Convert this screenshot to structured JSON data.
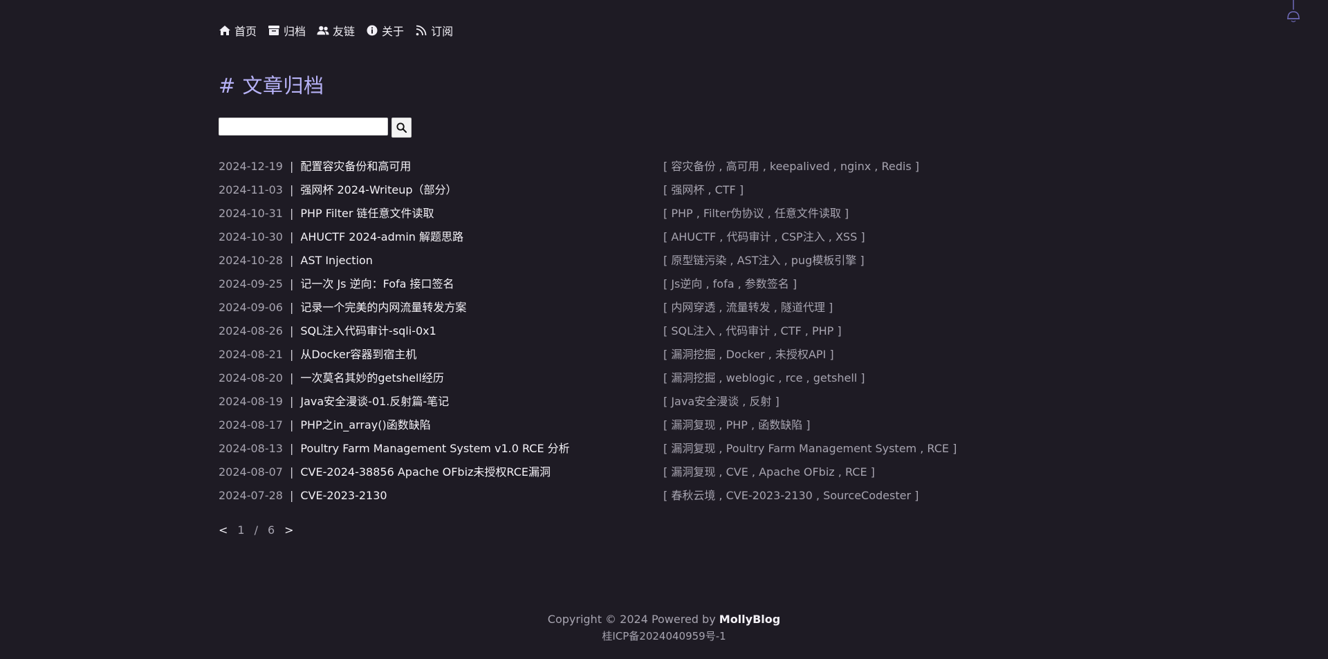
{
  "nav": {
    "items": [
      {
        "label": "首页",
        "icon": "home-icon"
      },
      {
        "label": "归档",
        "icon": "archive-icon"
      },
      {
        "label": "友链",
        "icon": "users-icon"
      },
      {
        "label": "关于",
        "icon": "info-icon"
      },
      {
        "label": "订阅",
        "icon": "rss-icon"
      }
    ]
  },
  "title": "# 文章归档",
  "search": {
    "value": "",
    "placeholder": ""
  },
  "posts": [
    {
      "date": "2024-12-19",
      "title": "配置容灾备份和高可用",
      "tags": [
        "容灾备份",
        "高可用",
        "keepalived",
        "nginx",
        "Redis"
      ]
    },
    {
      "date": "2024-11-03",
      "title": "强网杯 2024-Writeup（部分）",
      "tags": [
        "强网杯",
        "CTF"
      ]
    },
    {
      "date": "2024-10-31",
      "title": "PHP Filter 链任意文件读取",
      "tags": [
        "PHP",
        "Filter伪协议",
        "任意文件读取"
      ]
    },
    {
      "date": "2024-10-30",
      "title": "AHUCTF 2024-admin 解题思路",
      "tags": [
        "AHUCTF",
        "代码审计",
        "CSP注入",
        "XSS"
      ]
    },
    {
      "date": "2024-10-28",
      "title": "AST Injection",
      "tags": [
        "原型链污染",
        "AST注入",
        "pug模板引擎"
      ]
    },
    {
      "date": "2024-09-25",
      "title": "记一次 Js 逆向：Fofa 接口签名",
      "tags": [
        "Js逆向",
        "fofa",
        "参数签名"
      ]
    },
    {
      "date": "2024-09-06",
      "title": "记录一个完美的内网流量转发方案",
      "tags": [
        "内网穿透",
        "流量转发",
        "隧道代理"
      ]
    },
    {
      "date": "2024-08-26",
      "title": "SQL注入代码审计-sqli-0x1",
      "tags": [
        "SQL注入",
        "代码审计",
        "CTF",
        "PHP"
      ]
    },
    {
      "date": "2024-08-21",
      "title": "从Docker容器到宿主机",
      "tags": [
        "漏洞挖掘",
        "Docker",
        "未授权API"
      ]
    },
    {
      "date": "2024-08-20",
      "title": "一次莫名其妙的getshell经历",
      "tags": [
        "漏洞挖掘",
        "weblogic",
        "rce",
        "getshell"
      ]
    },
    {
      "date": "2024-08-19",
      "title": "Java安全漫谈-01.反射篇-笔记",
      "tags": [
        "Java安全漫谈",
        "反射"
      ]
    },
    {
      "date": "2024-08-17",
      "title": "PHP之in_array()函数缺陷",
      "tags": [
        "漏洞复现",
        "PHP",
        "函数缺陷"
      ]
    },
    {
      "date": "2024-08-13",
      "title": "Poultry Farm Management System v1.0 RCE 分析",
      "tags": [
        "漏洞复现",
        "Poultry Farm Management System",
        "RCE"
      ]
    },
    {
      "date": "2024-08-07",
      "title": "CVE-2024-38856 Apache OFbiz未授权RCE漏洞",
      "tags": [
        "漏洞复现",
        "CVE",
        "Apache OFbiz",
        "RCE"
      ]
    },
    {
      "date": "2024-07-28",
      "title": "CVE-2023-2130",
      "tags": [
        "春秋云境",
        "CVE-2023-2130",
        "SourceCodester"
      ]
    }
  ],
  "pagination": {
    "prev": "<",
    "current": "1",
    "separator": "/",
    "total": "6",
    "next": ">"
  },
  "footer": {
    "copyright": "Copyright © 2024 Powered by ",
    "brand": "MollyBlog",
    "icp": "桂ICP备2024040959号-1"
  },
  "colors": {
    "background": "#1e1b24",
    "accent": "#b7b2f7"
  }
}
